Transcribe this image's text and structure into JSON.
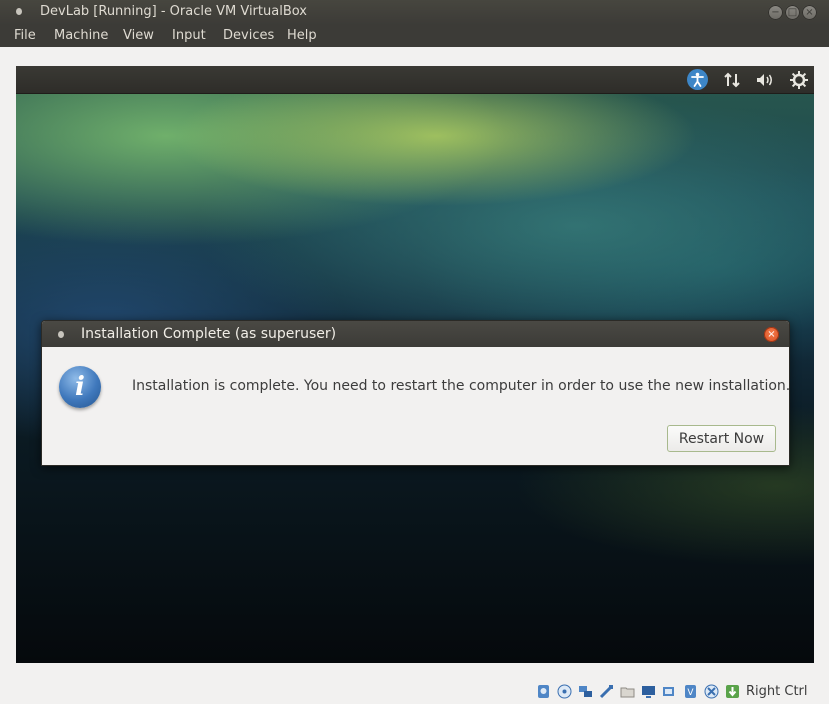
{
  "window": {
    "title": "DevLab [Running] - Oracle VM VirtualBox",
    "controls": {
      "minimize": "−",
      "maximize": "□",
      "close": "×"
    }
  },
  "menubar": {
    "items": [
      {
        "label": "File"
      },
      {
        "label": "Machine"
      },
      {
        "label": "View"
      },
      {
        "label": "Input"
      },
      {
        "label": "Devices"
      },
      {
        "label": "Help"
      }
    ]
  },
  "guest_panel": {
    "icons": [
      "accessibility-icon",
      "network-icon",
      "volume-icon",
      "system-gear-icon"
    ]
  },
  "dialog": {
    "title": "Installation Complete (as superuser)",
    "close": "×",
    "message": "Installation is complete. You need to restart the computer in order to use the new installation.",
    "info_glyph": "i",
    "button_label": "Restart Now"
  },
  "statusbar": {
    "icons": [
      "hard-disk-icon",
      "optical-drive-icon",
      "network-adapter-icon",
      "usb-icon",
      "shared-folders-icon",
      "display-icon",
      "video-capture-icon",
      "cpu-icon",
      "mouse-integration-icon",
      "keyboard-capture-icon"
    ],
    "host_key": "Right Ctrl"
  },
  "colors": {
    "titlebar": "#3c3b37",
    "dialog_close": "#e55b2a",
    "info_blue": "#3f78bc",
    "accessibility_blue": "#3d86c7"
  }
}
